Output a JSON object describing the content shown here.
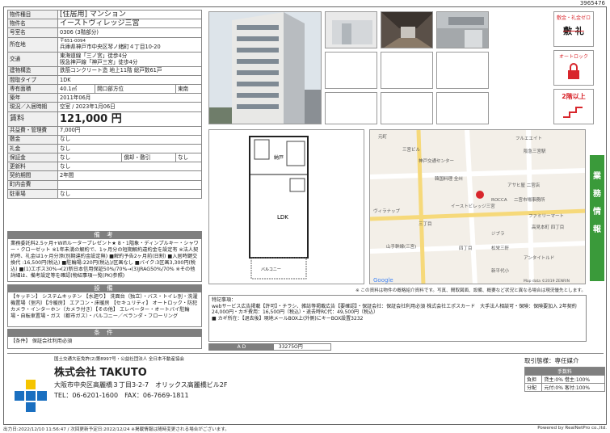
{
  "doc_id": "3965476",
  "spec": {
    "type_label": "物件種目",
    "type_value": "[住居用] マンション",
    "name_label": "物件名",
    "name_value": "イーストヴィレッジ三宮",
    "room_label": "号室名",
    "room_value": "0306 (3階部分)",
    "addr_label": "所在地",
    "addr_zip": "〒651-0094",
    "addr_value": "兵庫県神戸市中央区琴ノ緒町４丁目10-20",
    "access_label": "交通",
    "access_1": "東海道線「三ノ宮」徒歩4分",
    "access_2": "阪急神戸線「神戸三宮」徒歩4分",
    "structure_label": "建物構造",
    "structure_value": "鉄筋コンクリート造 地上11階 総戸数61戸",
    "layout_label": "間取タイプ",
    "layout_value": "1DK",
    "area_label": "専有面積",
    "area_value": "40.1㎡",
    "orient_label": "開口部方位",
    "orient_value": "東南",
    "built_label": "築年",
    "built_value": "2011年06月",
    "status_label": "現況／入居時期",
    "status_value": "空室 / 2023年1月06日",
    "rent_label": "賃料",
    "rent_value": "121,000 円",
    "mgmt_label": "共益費・管理費",
    "mgmt_value": "7,000円",
    "deposit_label": "敷金",
    "deposit_value": "なし",
    "keymoney_label": "礼金",
    "keymoney_value": "なし",
    "guarantee_label": "保証金",
    "guarantee_value": "なし",
    "amort_label": "償却・敷引",
    "amort_value": "なし",
    "renewal_label": "更新料",
    "renewal_value": "なし",
    "term_label": "契約期間",
    "term_value": "2年間",
    "assoc_label": "町内会費",
    "assoc_value": "",
    "parking_label": "駐車場",
    "parking_value": "なし"
  },
  "remarks_head": "備 考",
  "remarks_text": "業務委託料2.5ヶ月+Wifiルータープレゼント★ 8・1階象・ディンプルキー・シャワー・クローゼット ※1年未満の解約で、1ヶ月分の短期解約違約金を設定有 ※法人契約時、礼金は1ヶ月分添(別期違約金設定無) ■解約予告2ヶ月前(日割) ■入居時鍵交換代 :16,500円(税込) ■駐輪場:220円(税込)/区画なし ■バイク:3区画3,300円(税込) ■(1)エポス30%→(2)新日本信用保証50%/70%→(3)JRAG50%/70% ※その他詳細は、備考設定等を確認(物紹事項一覧(PK)参照)",
  "facilities_head": "設 備",
  "facilities_text": "【キッチン】 システムキッチン 【水廻り】 洗面台（独立）・バス・トイレ別・洗濯機置場（室内）【冷暖房】 エアコン・床暖房 【セキュリティ】 オートロック・防犯カメラ・インターホン（カメラ付き）【その他】 エレベーター・オートバイ駐輪場・自転車置場・ガス（都市ガス）・バルコニー／ベランダ・フローリング",
  "conditions_head": "条 件",
  "conditions_text": "【条件】 保証会社利用必須",
  "badges": {
    "badge1": "敷金・礼金ゼロ",
    "badge1_sub": "敷 礼",
    "badge2": "オートロック",
    "badge3": "2階以上"
  },
  "side_tab": "業務情報",
  "floorplan": {
    "storage": "納戸",
    "room": "LDK",
    "balcony": "バルコニー"
  },
  "map": {
    "labels": [
      "フルエエイト",
      "元町",
      "阪急三宮駅",
      "三宮ビル",
      "神戸交通センター",
      "韓国料理 全州",
      "アサヒ屋 二宮店",
      "ROCCA",
      "二宮市場事務所",
      "ファミリーマート",
      "イーストビレッジ三宮",
      "高見本町 四丁目",
      "ジブラ",
      "山手幹線(三宮)",
      "松栄三軒",
      "アンタイトルド",
      "ヴィラナップ",
      "三丁目",
      "四丁目",
      "新平代小",
      "Google",
      "Map data ©2019 ZENRIN"
    ],
    "note": "※ この資料は物件の概略紹介資料です。写真、間取図面、設備、概要など状況と異なる場合は現況優先とします。"
  },
  "remarks_box": {
    "title": "特記事項：",
    "line1": "webサービス広告掲載【許可】・チラシ、雑誌等掲載広告【要確認】・保証会社：保証会社利用必須 株式会社エポスカード　大手法人相談可・保険：保険要加入 2年契約 24,000円・カギ費用：16,500円（税込）・退去時RC代：49,500円（税込）",
    "line2": "■ カギ所在：【退去後】現地メールBOX上(外側)にキーBOX設置3232"
  },
  "ad": {
    "label": "A D",
    "value": "33275O円"
  },
  "footer": {
    "assoc": "国土交通大臣免許(2)第8997号・公益社団法人 全日本不動産協会",
    "company": "株式会社 TAKUTO",
    "address": "大阪市中央区高麗橋３丁目3-2-7　オリックス高麗橋ビル2F",
    "tel": "TEL：06-6201-1600　FAX：06-7669-1811",
    "trade_title": "取引態様：専任媒介",
    "fee_title": "手数料",
    "fee_burden_label": "負担",
    "fee_burden_value": "貸主:0% 借主:100%",
    "fee_split_label": "分配",
    "fee_split_value": "元付:0% 客付:100%"
  },
  "bottom": {
    "left": "出力日:2022/12/10 11:56:47 / 次回更新予定日:2022/12/24 ※掲載情報は随時変更される場合がございます。",
    "right": "Powered by RealNetPro co.,ltd."
  },
  "colors": {
    "header_gray": "#7f7f7f",
    "label_gray": "#efefef",
    "side_green": "#3a9a3a",
    "badge_red": "#d8262c",
    "logo_blue": "#1a6fc0",
    "logo_yellow": "#f5c400"
  }
}
